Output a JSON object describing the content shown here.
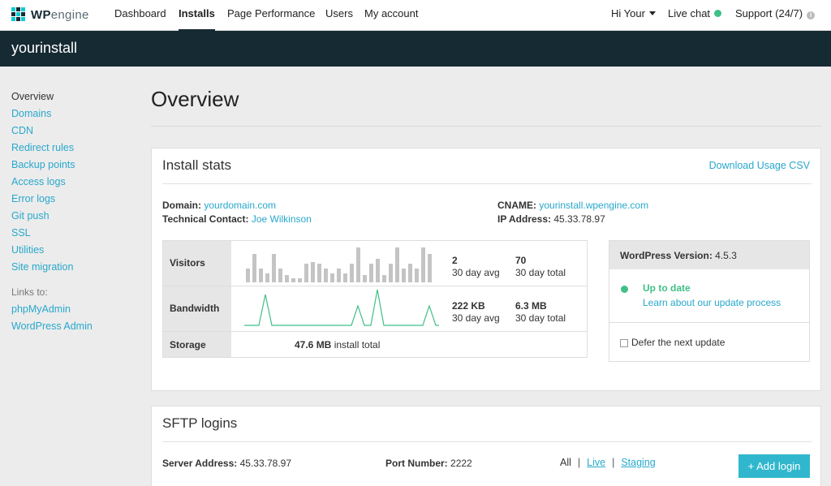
{
  "brand": {
    "logo_bold": "WP",
    "logo_light": "engine"
  },
  "topnav": {
    "items": [
      "Dashboard",
      "Installs",
      "Page Performance",
      "Users",
      "My account"
    ],
    "user_menu": "Hi Your",
    "live_chat": "Live chat",
    "support": "Support (24/7)"
  },
  "install": {
    "name": "yourinstall"
  },
  "sidebar": {
    "items": [
      "Overview",
      "Domains",
      "CDN",
      "Redirect rules",
      "Backup points",
      "Access logs",
      "Error logs",
      "Git push",
      "SSL",
      "Utilities",
      "Site migration"
    ],
    "links_label": "Links to:",
    "links": [
      "phpMyAdmin",
      "WordPress Admin"
    ]
  },
  "page": {
    "title": "Overview"
  },
  "install_stats": {
    "title": "Install stats",
    "download_csv": "Download Usage CSV",
    "domain_label": "Domain:",
    "domain_value": "yourdomain.com",
    "contact_label": "Technical Contact:",
    "contact_value": "Joe Wilkinson",
    "cname_label": "CNAME:",
    "cname_value": "yourinstall.wpengine.com",
    "ip_label": "IP Address:",
    "ip_value": "45.33.78.97",
    "visitors": {
      "label": "Visitors",
      "avg": "2",
      "avg_label": "30 day avg",
      "total": "70",
      "total_label": "30 day total"
    },
    "bandwidth": {
      "label": "Bandwidth",
      "avg": "222 KB",
      "avg_label": "30 day avg",
      "total": "6.3 MB",
      "total_label": "30 day total"
    },
    "storage": {
      "label": "Storage",
      "value": "47.6 MB",
      "value_label": "install total"
    }
  },
  "wordpress": {
    "version_label": "WordPress Version:",
    "version": "4.5.3",
    "status": "Up to date",
    "learn_link": "Learn about our update process",
    "defer": "Defer the next update"
  },
  "sftp": {
    "title": "SFTP logins",
    "server_label": "Server Address:",
    "server_value": "45.33.78.97",
    "port_label": "Port Number:",
    "port_value": "2222",
    "filter_all": "All",
    "filter_live": "Live",
    "filter_staging": "Staging",
    "add_login": "+ Add login"
  },
  "colors": {
    "accent": "#28a8cc",
    "dark": "#162a33",
    "success": "#40bf86",
    "button": "#31b7cd"
  }
}
